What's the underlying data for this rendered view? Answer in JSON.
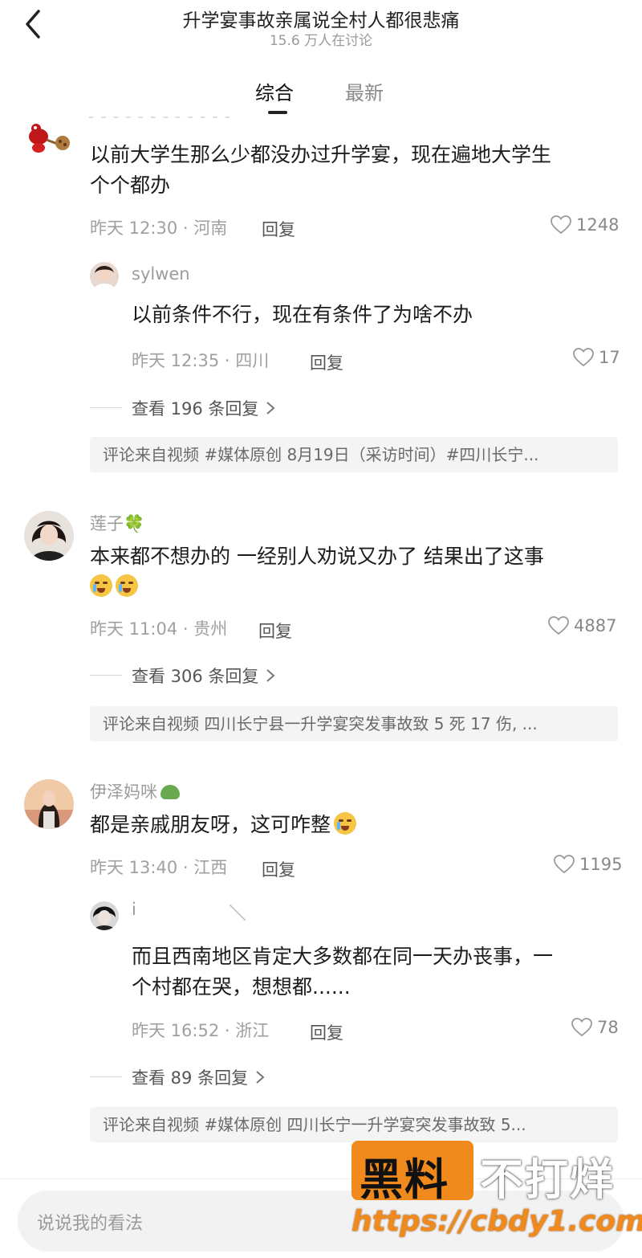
{
  "header": {
    "title": "升学宴事故亲属说全村人都很悲痛",
    "subtitle": "15.6 万人在讨论"
  },
  "tabs": [
    {
      "label": "综合",
      "active": true
    },
    {
      "label": "最新",
      "active": false
    }
  ],
  "comments": [
    {
      "text_line1": "以前大学生那么少都没办过升学宴，现在遍地大学生",
      "text_line2": "个个都办",
      "meta": "昨天 12:30 · 河南",
      "reply_label": "回复",
      "likes": "1248",
      "reply": {
        "name": "sylwen",
        "text": "以前条件不行，现在有条件了为啥不办",
        "meta": "昨天 12:35 · 四川",
        "reply_label": "回复",
        "likes": "17"
      },
      "more_replies": "查看 196 条回复",
      "source": "评论来自视频 #媒体原创 8月19日（采访时间）#四川长宁..."
    },
    {
      "name": "莲子🍀",
      "text_line1": "本来都不想办的 一经别人劝说又办了 结果出了这事",
      "meta": "昨天 11:04 · 贵州",
      "reply_label": "回复",
      "likes": "4887",
      "more_replies": "查看 306 条回复",
      "source": "评论来自视频 四川长宁县一升学宴突发事故致 5 死 17 伤, ..."
    },
    {
      "name": "伊泽妈咪",
      "text_line1": "都是亲戚朋友呀，这可咋整",
      "meta": "昨天 13:40 · 江西",
      "reply_label": "回复",
      "likes": "1195",
      "reply": {
        "name": "i",
        "text_line1": "而且西南地区肯定大多数都在同一天办丧事，一",
        "text_line2": "个村都在哭，想想都......",
        "meta": "昨天 16:52 · 浙江",
        "reply_label": "回复",
        "likes": "78"
      },
      "more_replies": "查看 89 条回复",
      "source": "评论来自视频 #媒体原创 四川长宁一升学宴突发事故致 5..."
    }
  ],
  "input": {
    "placeholder": "说说我的看法"
  },
  "watermark": {
    "part1": "黑料",
    "part2": "不打烊",
    "url": "https://cbdy1.com"
  },
  "colors": {
    "watermark_orange": "#f08a1c"
  },
  "icons": [
    "back-arrow-icon",
    "heart-icon",
    "chevron-right-icon",
    "crying-emoji-icon"
  ]
}
